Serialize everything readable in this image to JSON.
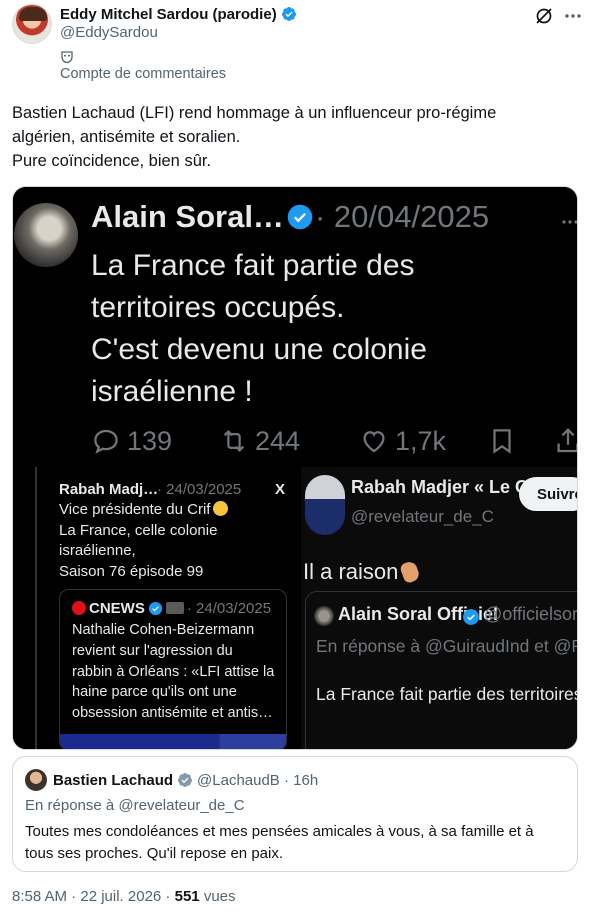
{
  "author": {
    "display_name": "Eddy Mitchel Sardou (parodie)",
    "handle": "@EddySardou",
    "account_type": "Compte de commentaires"
  },
  "tweet": {
    "lines": [
      "Bastien Lachaud (LFI) rend hommage à un influenceur pro-régime",
      "algérien, antisémite et soralien.",
      "Pure coïncidence, bien sûr."
    ]
  },
  "media": {
    "top_post": {
      "name": "Alain Soral…",
      "date": "· 20/04/2025",
      "lines": [
        "La France fait partie des",
        "territoires occupés.",
        "C'est devenu une colonie",
        "israélienne !"
      ],
      "stats": {
        "replies": "139",
        "reposts": "244",
        "likes": "1,7k"
      }
    },
    "left_post": {
      "name": "Rabah Madj…",
      "date": "· 24/03/2025",
      "x_label": "X",
      "lines": [
        "Vice présidente du Crif",
        "La France, celle colonie",
        "israélienne,",
        "Saison 76 épisode 99"
      ],
      "quote": {
        "brand": "CNEWS",
        "date": "· 24/03/2025",
        "lines": [
          "Nathalie Cohen-Beizermann",
          "revient sur l'agression du",
          "rabbin à Orléans : «LFI attise la",
          "haine parce qu'ils ont une",
          "obsession antisémite et antis…"
        ]
      }
    },
    "right_post": {
      "name": "Rabah Madjer « Le Ca…",
      "handle": "@revelateur_de_C",
      "follow_label": "Suivre",
      "text": "Il a raison",
      "quote": {
        "name": "Alain Soral Officiel",
        "handle": "@officielsoral ·",
        "reply_to": "En réponse à @GuiraudInd et @RimaHas",
        "text": "La France fait partie des territoires occupé"
      }
    }
  },
  "quoted_tweet": {
    "name": "Bastien Lachaud",
    "handle": "@LachaudB · 16h",
    "reply_to": "En réponse à @revelateur_de_C",
    "lines": [
      "Toutes mes condoléances et mes pensées amicales à vous, à sa famille et à",
      "tous ses proches. Qu'il repose en paix."
    ]
  },
  "meta": {
    "time_date": "8:58 AM · 22 juil. 2026 ·",
    "views_count": "551",
    "views_label": "vues"
  },
  "colors": {
    "verified_blue": "#1d9bf0",
    "verified_gray": "#829aab",
    "secondary_text": "#536471"
  }
}
